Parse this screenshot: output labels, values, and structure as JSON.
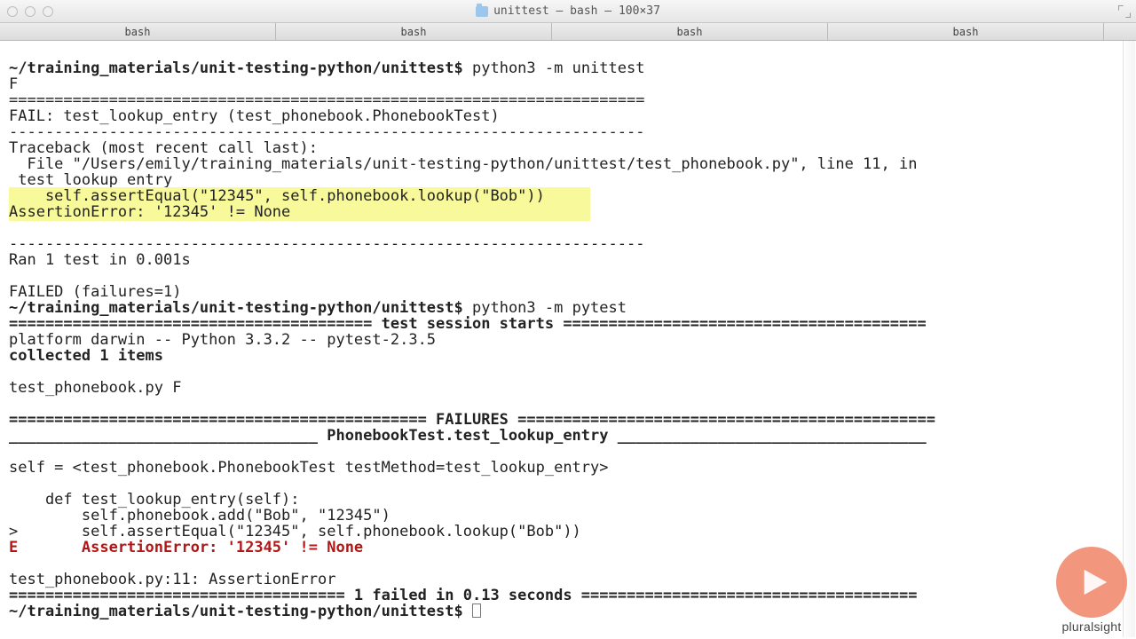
{
  "window": {
    "title": "unittest — bash — 100×37"
  },
  "tabs": {
    "items": [
      "bash",
      "bash",
      "bash",
      "bash"
    ]
  },
  "prompt": "~/training_materials/unit-testing-python/unittest$",
  "cmd": {
    "unittest": "python3 -m unittest",
    "pytest": "python3 -m pytest"
  },
  "ut": {
    "progress": "F",
    "rule_s": "----------------------------------------------------------------------",
    "rule_d": "======================================================================",
    "fail_title": "FAIL: test_lookup_entry (test_phonebook.PhonebookTest)",
    "tb_head": "Traceback (most recent call last):",
    "tb_file": "  File \"/Users/emily/training_materials/unit-testing-python/unittest/test_phonebook.py\", line 11, in",
    "tb_file2": " test_lookup_entry",
    "tb_line": "    self.assertEqual(\"12345\", self.phonebook.lookup(\"Bob\"))",
    "tb_err": "AssertionError: '12345' != None",
    "ran": "Ran 1 test in 0.001s",
    "failed": "FAILED (failures=1)"
  },
  "pt": {
    "session_line": "============================= test session starts =============================",
    "platform": "platform darwin -- Python 3.3.2 -- pytest-2.3.5",
    "collected": "collected 1 items",
    "file_result": "test_phonebook.py F",
    "fail_rule": "=================================== FAILURES ===================================",
    "test_under": "________________________ PhonebookTest.test_lookup_entry ________________________",
    "self_line": "self = <test_phonebook.PhonebookTest testMethod=test_lookup_entry>",
    "def_line": "    def test_lookup_entry(self):",
    "add_line": "        self.phonebook.add(\"Bob\", \"12345\")",
    "gt_line": ">       self.assertEqual(\"12345\", self.phonebook.lookup(\"Bob\"))",
    "e_line": "E       AssertionError: '12345' != None",
    "loc_line": "test_phonebook.py:11: AssertionError",
    "summary": "=========================== 1 failed in 0.13 seconds ==========================="
  },
  "watermark": {
    "brand": "pluralsight"
  }
}
